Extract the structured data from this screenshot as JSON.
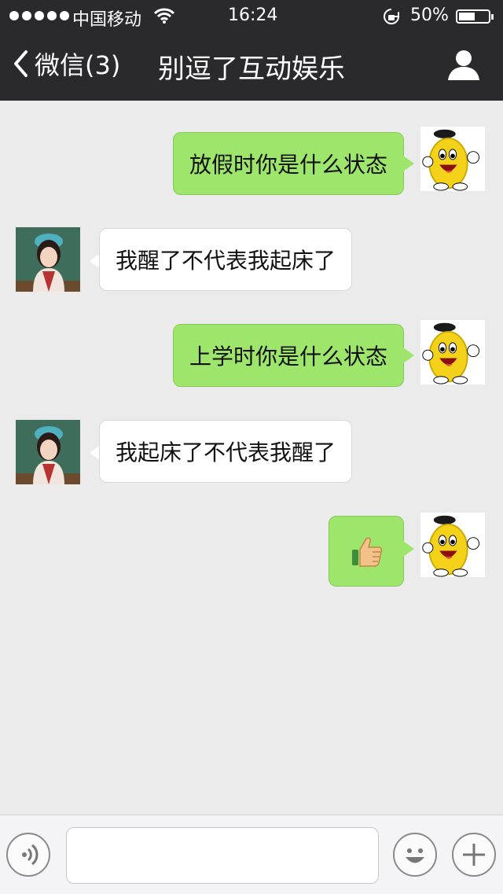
{
  "status_bar": {
    "carrier": "中国移动",
    "time": "16:24",
    "battery": "50%",
    "icons": [
      "signal-dots",
      "wifi-icon",
      "rotation-lock-icon",
      "battery-icon"
    ]
  },
  "nav": {
    "back_label": "微信(3)",
    "title": "别逗了互动娱乐",
    "icons": [
      "chevron-left-icon",
      "profile-icon"
    ]
  },
  "messages": [
    {
      "side": "out",
      "text": "放假时你是什么状态",
      "avatar": "mascot-avatar"
    },
    {
      "side": "in",
      "text": "我醒了不代表我起床了",
      "avatar": "girl-avatar"
    },
    {
      "side": "out",
      "text": "上学时你是什么状态",
      "avatar": "mascot-avatar"
    },
    {
      "side": "in",
      "text": "我起床了不代表我醒了",
      "avatar": "girl-avatar"
    },
    {
      "side": "out",
      "text": "",
      "emoji": "thumbs-up-icon",
      "avatar": "mascot-avatar"
    }
  ],
  "toolbar": {
    "icons": [
      "voice-icon",
      "emoji-icon",
      "plus-icon"
    ]
  },
  "colors": {
    "header_bg": "#2a2a2d",
    "chat_bg": "#ebebeb",
    "outgoing_bubble": "#9ee66b",
    "incoming_bubble": "#ffffff"
  }
}
